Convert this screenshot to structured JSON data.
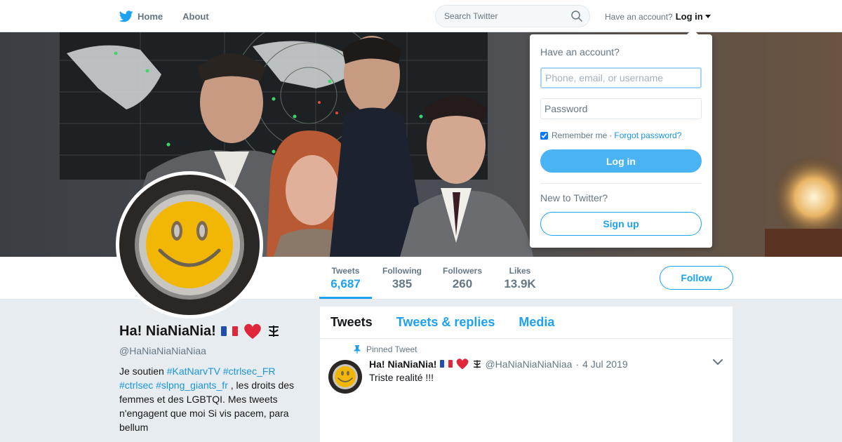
{
  "nav": {
    "home_label": "Home",
    "about_label": "About",
    "search_placeholder": "Search Twitter",
    "have_account": "Have an account?",
    "login_label": "Log in"
  },
  "profile": {
    "name": "Ha! NiaNiaNia!",
    "handle": "@HaNiaNiaNiaNiaa",
    "bio_prefix": "Je soutien ",
    "tags": [
      "#KatNarvTV",
      "#ctrlsec_FR",
      "#ctrlsec",
      "#slpng_giants_fr"
    ],
    "bio_suffix": " , les droits des femmes et des LGBTQI. Mes tweets n'engagent que moi Si vis pacem, para bellum",
    "follow_label": "Follow"
  },
  "stats": [
    {
      "label": "Tweets",
      "value": "6,687",
      "active": true
    },
    {
      "label": "Following",
      "value": "385",
      "active": false
    },
    {
      "label": "Followers",
      "value": "260",
      "active": false
    },
    {
      "label": "Likes",
      "value": "13.9K",
      "active": false
    }
  ],
  "timeline": {
    "tabs": [
      {
        "label": "Tweets",
        "active": true
      },
      {
        "label": "Tweets & replies",
        "active": false
      },
      {
        "label": "Media",
        "active": false
      }
    ],
    "pinned_tweet": {
      "pinned_label": "Pinned Tweet",
      "author_name": "Ha! NiaNiaNia!",
      "author_handle": "@HaNiaNiaNiaNiaa",
      "separator": "·",
      "date": "4 Jul 2019",
      "text": "Triste realité !!!"
    }
  },
  "login_dropdown": {
    "title": "Have an account?",
    "username_placeholder": "Phone, email, or username",
    "password_placeholder": "Password",
    "remember_label": "Remember me",
    "separator": "·",
    "forgot_label": "Forgot password?",
    "login_button": "Log in",
    "new_label": "New to Twitter?",
    "signup_button": "Sign up"
  },
  "colors": {
    "accent": "#1da1f2",
    "login_button": "#4ab3f4",
    "background": "#e6ecf0",
    "smiley": "#f2b705"
  },
  "icons": {
    "nav_home": "twitter-bird-icon",
    "search": "search-icon",
    "pinned": "pin-icon",
    "menu": "chevron-down-icon",
    "name_emoji": [
      "flag-france",
      "red-heart",
      "amazigh-yaz-symbol"
    ]
  }
}
